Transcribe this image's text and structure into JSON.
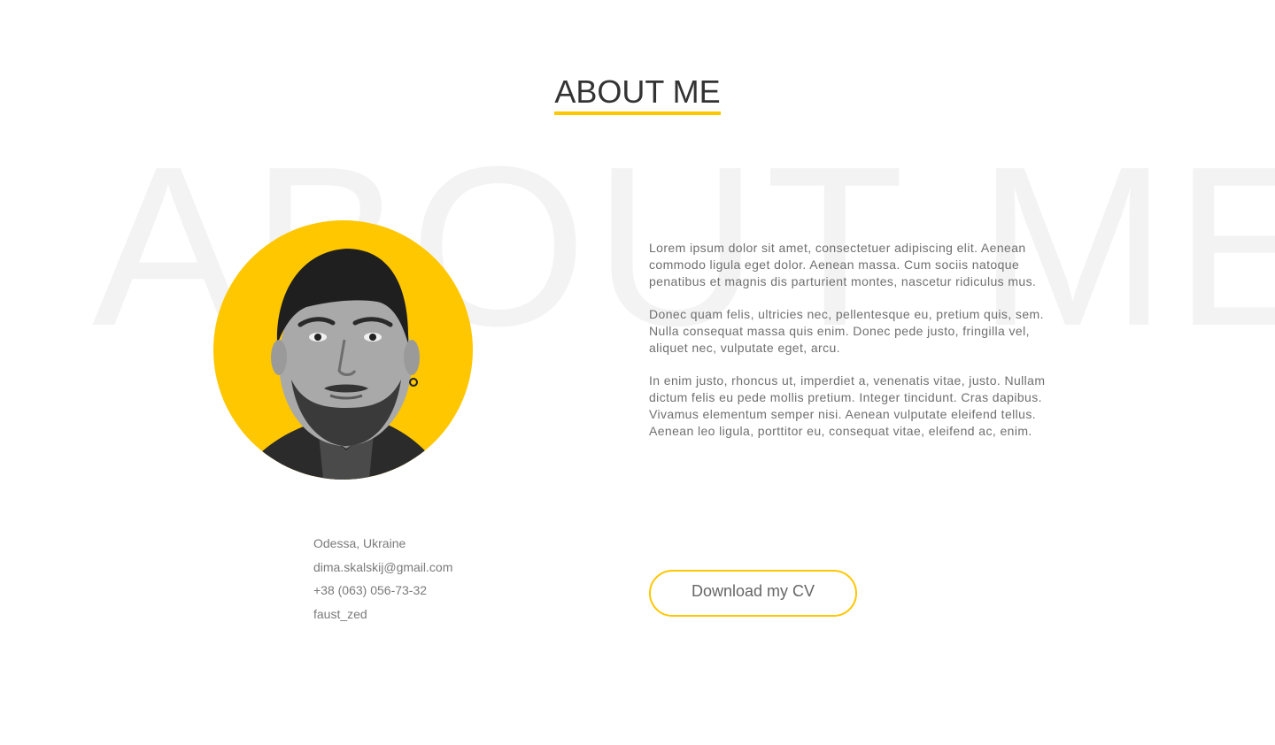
{
  "section": {
    "title": "ABOUT ME",
    "watermark": "ABOUT ME"
  },
  "colors": {
    "accent": "#ffc700",
    "title": "#333333",
    "body_text": "#6f6f6f",
    "watermark": "#f3f3f3"
  },
  "bio": {
    "paragraphs": [
      "Lorem ipsum dolor sit amet, consectetuer adipiscing elit. Aenean commodo ligula eget dolor. Aenean massa. Cum sociis natoque penatibus et magnis dis parturient montes, nascetur ridiculus mus.",
      "Donec quam felis, ultricies nec, pellentesque eu, pretium quis, sem. Nulla consequat massa quis enim. Donec pede justo, fringilla vel, aliquet nec, vulputate eget, arcu.",
      "In enim justo, rhoncus ut, imperdiet a, venenatis vitae, justo. Nullam dictum felis eu pede mollis pretium. Integer tincidunt. Cras dapibus. Vivamus elementum semper nisi. Aenean vulputate eleifend tellus. Aenean leo ligula, porttitor eu, consequat vitae, eleifend ac, enim."
    ]
  },
  "contacts": {
    "location": "Odessa, Ukraine",
    "email": "dima.skalskij@gmail.com",
    "phone": "+38 (063) 056-73-32",
    "username": "faust_zed"
  },
  "cv": {
    "button_label": "Download my CV"
  },
  "avatar": {
    "icon": "profile-photo"
  }
}
